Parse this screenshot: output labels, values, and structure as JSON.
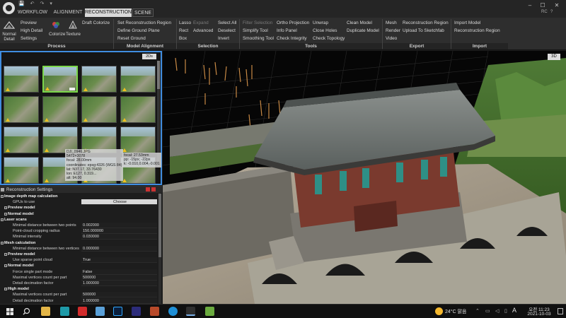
{
  "window": {
    "menu_tabs": [
      "WORKFLOW",
      "ALIGNMENT",
      "RECONSTRUCTION",
      "SCENE"
    ],
    "user_initials": "RC",
    "controls": [
      "–",
      "☐",
      "✕"
    ],
    "quick_access": [
      "💾",
      "↶",
      "↷",
      "▾"
    ]
  },
  "ribbon": {
    "process": {
      "title": "Process",
      "normal_detail": "Normal Detail",
      "preview": "Preview",
      "high_detail": "High Detail",
      "settings": "Settings",
      "colorize": "Colorize",
      "texture": "Texture",
      "draft_colorize": "Draft Colorize"
    },
    "model_alignment": {
      "title": "Model Alignment",
      "set_region": "Set Reconstruction Region",
      "define_ground": "Define Ground Plane",
      "reset_ground": "Reset Ground"
    },
    "selection": {
      "title": "Selection",
      "lasso": "Lasso",
      "expand": "Expand",
      "rect": "Rect",
      "advanced": "Advanced",
      "box": "Box",
      "select_all": "Select All",
      "deselect": "Deselect",
      "invert": "Invert"
    },
    "tools": {
      "title": "Tools",
      "filter_selection": "Filter Selection",
      "simplify_tool": "Simplify Tool",
      "smoothing_tool": "Smoothing Tool",
      "ortho_projection": "Ortho Projection",
      "info_panel": "Info Panel",
      "check_integrity": "Check Integrity",
      "unwrap": "Unwrap",
      "close_holes": "Close Holes",
      "check_topology": "Check Topology",
      "clean_model": "Clean Model",
      "duplicate_model": "Duplicate Model"
    },
    "export": {
      "title": "Export",
      "mesh": "Mesh",
      "render": "Render",
      "video": "Video",
      "reconstruction_region": "Reconstruction Region",
      "upload_sketchfab": "Upload To Sketchfab"
    },
    "import": {
      "title": "Import",
      "import_model": "Import Model",
      "reconstruction_region": "Reconstruction Region"
    }
  },
  "images_panel": {
    "view_label": "2Ds",
    "tooltip": {
      "filename": "DJI_0946.JPG",
      "size": "5472×3078",
      "focal": "focal: 28.00mm",
      "coordinates": "coordinates: epsg:4326 (WGS 84)",
      "lat": "lat: N37.17, 33.76430",
      "lon": "lon: E127, 0.319...",
      "alt": "alt: 94.00",
      "focal2": "focal: 27.53mm",
      "pp": "pp: -15px; -22px",
      "k": "k: -0.010,0.004,-0.001"
    }
  },
  "settings": {
    "title": "Reconstruction Settings",
    "rows": [
      {
        "type": "h",
        "key": "Image depth map calculation",
        "value": ""
      },
      {
        "type": "kv",
        "key": "GPUs to use",
        "value": "Choose"
      },
      {
        "type": "sh",
        "key": "Preview model",
        "value": ""
      },
      {
        "type": "sh",
        "key": "Normal model",
        "value": ""
      },
      {
        "type": "h",
        "key": "Laser scans",
        "value": ""
      },
      {
        "type": "kv",
        "key": "Minimal distance between two points",
        "value": "0.002000"
      },
      {
        "type": "kv",
        "key": "Point-cloud cropping radius",
        "value": "150.000000"
      },
      {
        "type": "kv",
        "key": "Minimal intensity",
        "value": "0.030000"
      },
      {
        "type": "h",
        "key": "Mesh calculation",
        "value": ""
      },
      {
        "type": "kv",
        "key": "Minimal distance between two vertices",
        "value": "0.000000"
      },
      {
        "type": "sh",
        "key": "Preview model",
        "value": ""
      },
      {
        "type": "kv",
        "key": "Use sparse point cloud",
        "value": "True"
      },
      {
        "type": "sh",
        "key": "Normal model",
        "value": ""
      },
      {
        "type": "kv",
        "key": "Force single part mode",
        "value": "False"
      },
      {
        "type": "kv",
        "key": "Maximal vertices count per part",
        "value": "500000"
      },
      {
        "type": "kv",
        "key": "Detail decimation factor",
        "value": "1.000000"
      },
      {
        "type": "sh",
        "key": "High model",
        "value": ""
      },
      {
        "type": "kv",
        "key": "Maximal vertices count per part",
        "value": "500000"
      },
      {
        "type": "kv",
        "key": "Detail decimation factor",
        "value": "1.000000"
      }
    ]
  },
  "viewport": {
    "view_label": "3D"
  },
  "taskbar": {
    "weather": "24°C 맑음",
    "time": "오전 11:23",
    "date": "2021-10-03",
    "ime": "A"
  }
}
